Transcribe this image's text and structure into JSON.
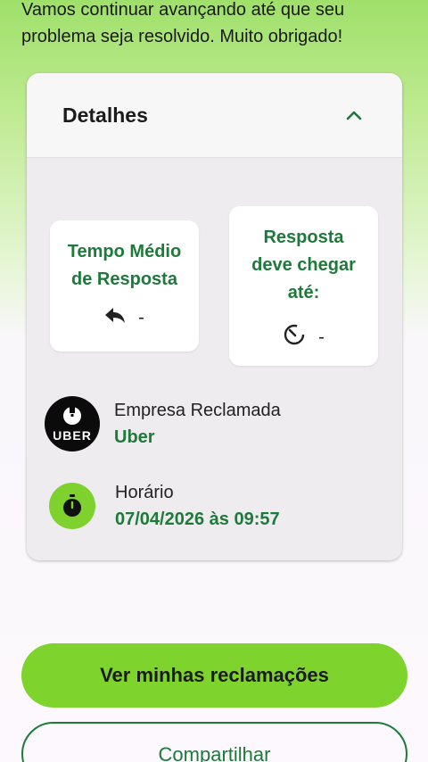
{
  "intro_text": "Vamos continuar avançando até que seu problema seja resolvido. Muito obrigado!",
  "details": {
    "title": "Detalhes",
    "toggle_icon": "chevron-up-icon",
    "avg_response": {
      "title": "Tempo Médio de Resposta",
      "icon": "reply-arrow-icon",
      "value": "-"
    },
    "response_deadline": {
      "title": "Resposta deve chegar até:",
      "icon": "countdown-timer-icon",
      "value": "-"
    },
    "company": {
      "label": "Empresa Reclamada",
      "value": "Uber",
      "logo_text": "UBER"
    },
    "time": {
      "label": "Horário",
      "value": "07/04/2026 às 09:57",
      "icon": "stopwatch-icon"
    }
  },
  "buttons": {
    "primary_label": "Ver minhas reclamações",
    "secondary_label": "Compartilhar"
  },
  "colors": {
    "accent_green": "#7ed32c",
    "text_green": "#1e7a3a",
    "card_bg": "#eeecee"
  }
}
